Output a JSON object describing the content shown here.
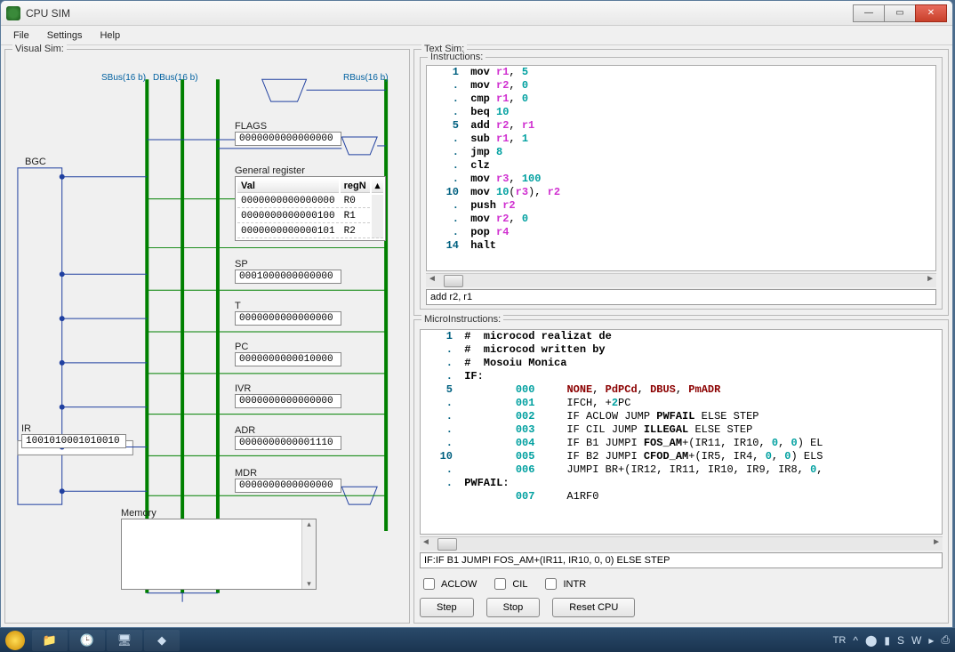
{
  "window": {
    "title": "CPU SIM"
  },
  "menu": {
    "file": "File",
    "settings": "Settings",
    "help": "Help"
  },
  "panels": {
    "visual": "Visual Sim:",
    "text": "Text Sim:",
    "instr": "Instructions:",
    "micro": "MicroInstructions:"
  },
  "buses": {
    "sbus": "SBus(16 b)",
    "dbus": "DBus(16 b)",
    "rbus": "RBus(16 b)"
  },
  "blocks": {
    "bgc": "BGC",
    "ir_label": "IR",
    "memory_label": "Memory"
  },
  "registers": {
    "flags": {
      "label": "FLAGS",
      "value": "0000000000000000"
    },
    "sp": {
      "label": "SP",
      "value": "0001000000000000"
    },
    "t": {
      "label": "T",
      "value": "0000000000000000"
    },
    "pc": {
      "label": "PC",
      "value": "0000000000010000"
    },
    "ivr": {
      "label": "IVR",
      "value": "0000000000000000"
    },
    "adr": {
      "label": "ADR",
      "value": "0000000000001110"
    },
    "mdr": {
      "label": "MDR",
      "value": "0000000000000000"
    },
    "ir": {
      "value": "1001010001010010"
    }
  },
  "gen_reg": {
    "label": "General register",
    "headers": {
      "val": "Val",
      "n": "regN"
    },
    "rows": [
      {
        "val": "0000000000000000",
        "n": "R0"
      },
      {
        "val": "0000000000000100",
        "n": "R1"
      },
      {
        "val": "0000000000000101",
        "n": "R2"
      }
    ]
  },
  "instr_gutter": [
    "1",
    ".",
    ".",
    ".",
    "5",
    ".",
    ".",
    ".",
    ".",
    "10",
    ".",
    ".",
    ".",
    "14"
  ],
  "instructions": [
    [
      {
        "c": "kw",
        "t": "mov "
      },
      {
        "c": "reg",
        "t": "r1"
      },
      {
        "c": "",
        "t": ", "
      },
      {
        "c": "num",
        "t": "5"
      }
    ],
    [
      {
        "c": "kw",
        "t": "mov "
      },
      {
        "c": "reg",
        "t": "r2"
      },
      {
        "c": "",
        "t": ", "
      },
      {
        "c": "num",
        "t": "0"
      }
    ],
    [
      {
        "c": "kw",
        "t": "cmp "
      },
      {
        "c": "reg",
        "t": "r1"
      },
      {
        "c": "",
        "t": ", "
      },
      {
        "c": "num",
        "t": "0"
      }
    ],
    [
      {
        "c": "kw",
        "t": "beq "
      },
      {
        "c": "num",
        "t": "10"
      }
    ],
    [
      {
        "c": "kw",
        "t": "add "
      },
      {
        "c": "reg",
        "t": "r2"
      },
      {
        "c": "",
        "t": ", "
      },
      {
        "c": "reg",
        "t": "r1"
      }
    ],
    [
      {
        "c": "kw",
        "t": "sub "
      },
      {
        "c": "reg",
        "t": "r1"
      },
      {
        "c": "",
        "t": ", "
      },
      {
        "c": "num",
        "t": "1"
      }
    ],
    [
      {
        "c": "kw",
        "t": "jmp "
      },
      {
        "c": "num",
        "t": "8"
      }
    ],
    [
      {
        "c": "kw",
        "t": "clz"
      }
    ],
    [
      {
        "c": "kw",
        "t": "mov "
      },
      {
        "c": "reg",
        "t": "r3"
      },
      {
        "c": "",
        "t": ", "
      },
      {
        "c": "num",
        "t": "100"
      }
    ],
    [
      {
        "c": "kw",
        "t": "mov "
      },
      {
        "c": "num",
        "t": "10"
      },
      {
        "c": "",
        "t": "("
      },
      {
        "c": "reg",
        "t": "r3"
      },
      {
        "c": "",
        "t": "), "
      },
      {
        "c": "reg",
        "t": "r2"
      }
    ],
    [
      {
        "c": "kw",
        "t": "push "
      },
      {
        "c": "reg",
        "t": "r2"
      }
    ],
    [
      {
        "c": "kw",
        "t": "mov "
      },
      {
        "c": "reg",
        "t": "r2"
      },
      {
        "c": "",
        "t": ", "
      },
      {
        "c": "num",
        "t": "0"
      }
    ],
    [
      {
        "c": "kw",
        "t": "pop "
      },
      {
        "c": "reg",
        "t": "r4"
      }
    ],
    [
      {
        "c": "kw",
        "t": "halt"
      }
    ]
  ],
  "instr_status": "add r2, r1",
  "micro_gutter": [
    "1",
    ".",
    ".",
    ".",
    "5",
    ".",
    ".",
    ".",
    ".",
    "10",
    ".",
    "."
  ],
  "micro": [
    [
      {
        "c": "cmt",
        "t": "#  microcod realizat de"
      }
    ],
    [
      {
        "c": "cmt",
        "t": "#  microcod written by"
      }
    ],
    [
      {
        "c": "cmt",
        "t": "#  Mosoiu Monica"
      }
    ],
    [
      {
        "c": "lbl",
        "t": "IF:"
      }
    ],
    [
      {
        "c": "",
        "t": "        "
      },
      {
        "c": "addr",
        "t": "000"
      },
      {
        "c": "",
        "t": "     "
      },
      {
        "c": "op",
        "t": "NONE"
      },
      {
        "c": "",
        "t": ", "
      },
      {
        "c": "op",
        "t": "PdPCd"
      },
      {
        "c": "",
        "t": ", "
      },
      {
        "c": "op",
        "t": "DBUS"
      },
      {
        "c": "",
        "t": ", "
      },
      {
        "c": "op",
        "t": "PmADR"
      }
    ],
    [
      {
        "c": "",
        "t": "        "
      },
      {
        "c": "addr",
        "t": "001"
      },
      {
        "c": "",
        "t": "     IFCH, +"
      },
      {
        "c": "num",
        "t": "2"
      },
      {
        "c": "",
        "t": "PC"
      }
    ],
    [
      {
        "c": "",
        "t": "        "
      },
      {
        "c": "addr",
        "t": "002"
      },
      {
        "c": "",
        "t": "     IF ACLOW JUMP "
      },
      {
        "c": "lbl",
        "t": "PWFAIL"
      },
      {
        "c": "",
        "t": " ELSE STEP"
      }
    ],
    [
      {
        "c": "",
        "t": "        "
      },
      {
        "c": "addr",
        "t": "003"
      },
      {
        "c": "",
        "t": "     IF CIL JUMP "
      },
      {
        "c": "lbl",
        "t": "ILLEGAL"
      },
      {
        "c": "",
        "t": " ELSE STEP"
      }
    ],
    [
      {
        "c": "",
        "t": "        "
      },
      {
        "c": "addr",
        "t": "004"
      },
      {
        "c": "",
        "t": "     IF B1 JUMPI "
      },
      {
        "c": "lbl",
        "t": "FOS_AM"
      },
      {
        "c": "",
        "t": "+(IR11, IR10, "
      },
      {
        "c": "num",
        "t": "0"
      },
      {
        "c": "",
        "t": ", "
      },
      {
        "c": "num",
        "t": "0"
      },
      {
        "c": "",
        "t": ") EL"
      }
    ],
    [
      {
        "c": "",
        "t": "        "
      },
      {
        "c": "addr",
        "t": "005"
      },
      {
        "c": "",
        "t": "     IF B2 JUMPI "
      },
      {
        "c": "lbl",
        "t": "CFOD_AM"
      },
      {
        "c": "",
        "t": "+(IR5, IR4, "
      },
      {
        "c": "num",
        "t": "0"
      },
      {
        "c": "",
        "t": ", "
      },
      {
        "c": "num",
        "t": "0"
      },
      {
        "c": "",
        "t": ") ELS"
      }
    ],
    [
      {
        "c": "",
        "t": "        "
      },
      {
        "c": "addr",
        "t": "006"
      },
      {
        "c": "",
        "t": "     JUMPI BR+(IR12, IR11, IR10, IR9, IR8, "
      },
      {
        "c": "num",
        "t": "0"
      },
      {
        "c": "",
        "t": ","
      }
    ],
    [
      {
        "c": "lbl",
        "t": "PWFAIL:"
      }
    ]
  ],
  "micro_trailer": [
    {
      "c": "",
      "t": "        "
    },
    {
      "c": "addr",
      "t": "007"
    },
    {
      "c": "",
      "t": "     A1RF0"
    }
  ],
  "micro_status": "IF:IF B1 JUMPI FOS_AM+(IR11, IR10, 0, 0) ELSE STEP",
  "checks": {
    "aclow": "ACLOW",
    "cil": "CIL",
    "intr": "INTR"
  },
  "buttons": {
    "step": "Step",
    "stop": "Stop",
    "reset": "Reset CPU"
  },
  "tray": {
    "lang": "TR"
  }
}
